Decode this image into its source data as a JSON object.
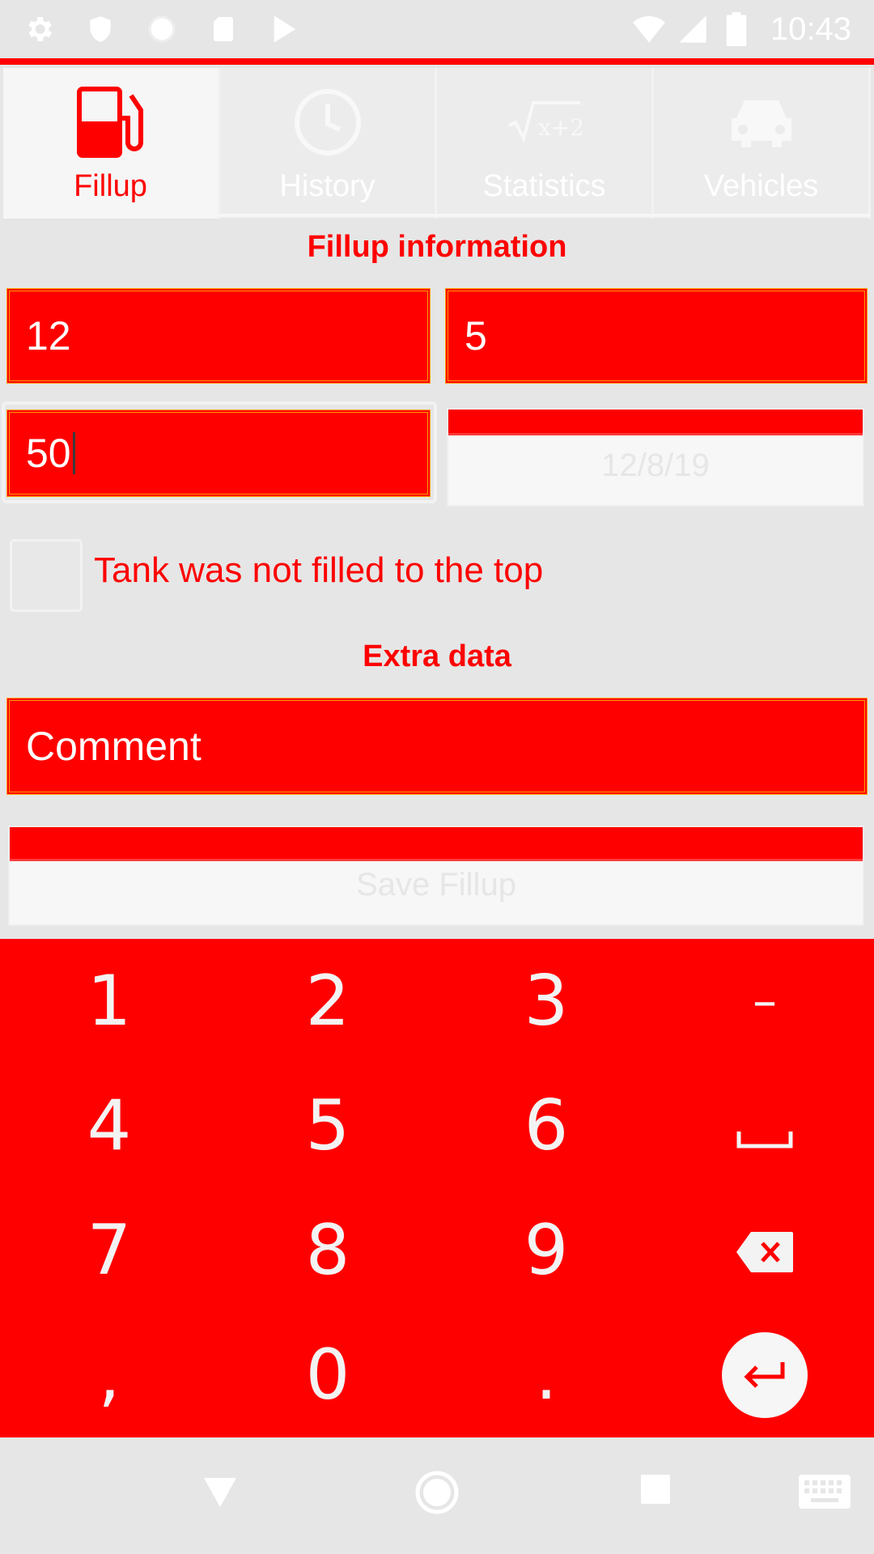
{
  "status_bar": {
    "time": "10:43",
    "left_icons": [
      "gear-icon",
      "shield-icon",
      "circle-icon",
      "sd-card-icon",
      "play-store-icon"
    ],
    "right_icons": [
      "wifi-icon",
      "signal-icon",
      "battery-icon"
    ]
  },
  "tabs": [
    {
      "label": "Fillup",
      "icon": "fuel-pump-icon",
      "active": true
    },
    {
      "label": "History",
      "icon": "clock-icon",
      "active": false
    },
    {
      "label": "Statistics",
      "icon": "sqrt-formula-icon",
      "active": false
    },
    {
      "label": "Vehicles",
      "icon": "car-icon",
      "active": false
    }
  ],
  "fillup": {
    "section_title": "Fillup information",
    "field1_value": "12",
    "field2_value": "5",
    "field3_value": "50",
    "date_label": "12/8/19",
    "not_full_label": "Tank was not filled to the top"
  },
  "extra": {
    "section_title": "Extra data",
    "comment_placeholder": "Comment",
    "save_label": "Save Fillup"
  },
  "keypad": {
    "keys": [
      "1",
      "2",
      "3",
      "–",
      "4",
      "5",
      "6",
      "space",
      "7",
      "8",
      "9",
      "backspace",
      ",",
      "0",
      ".",
      "enter"
    ]
  },
  "colors": {
    "accent": "#ff0000",
    "background": "#e6e6e6",
    "border_accent": "#ff9a00"
  }
}
